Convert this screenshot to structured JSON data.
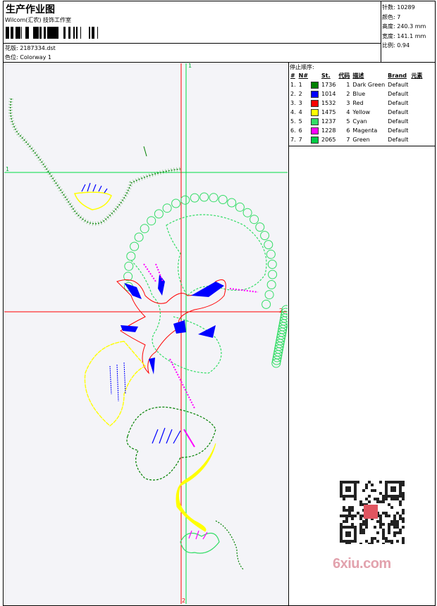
{
  "header": {
    "title": "生产作业图",
    "studio": "Wilcom(汇农) 技饰工作室",
    "design_label": "花版:",
    "design_value": "2187334.dst",
    "colorway_label": "色位:",
    "colorway_value": "Colorway 1"
  },
  "stats": [
    {
      "label": "针数:",
      "value": "10289"
    },
    {
      "label": "颜色:",
      "value": "7"
    },
    {
      "label": "高度:",
      "value": "240.3 mm"
    },
    {
      "label": "宽度:",
      "value": "141.1 mm"
    },
    {
      "label": "比例:",
      "value": "0.94"
    }
  ],
  "stop_sequence": {
    "heading": "停止顺序:",
    "columns": [
      "#",
      "N#",
      "St.",
      "代码",
      "描述",
      "Brand",
      "元素"
    ],
    "rows": [
      {
        "num": "1.",
        "n": "1",
        "color": "#008000",
        "st": "1736",
        "code": "1",
        "desc": "Dark Green",
        "brand": "Default"
      },
      {
        "num": "2.",
        "n": "2",
        "color": "#0000ff",
        "st": "1014",
        "code": "2",
        "desc": "Blue",
        "brand": "Default"
      },
      {
        "num": "3.",
        "n": "3",
        "color": "#ff0000",
        "st": "1532",
        "code": "3",
        "desc": "Red",
        "brand": "Default"
      },
      {
        "num": "4.",
        "n": "4",
        "color": "#ffff00",
        "st": "1475",
        "code": "4",
        "desc": "Yellow",
        "brand": "Default"
      },
      {
        "num": "5.",
        "n": "5",
        "color": "#33dd66",
        "st": "1237",
        "code": "5",
        "desc": "Cyan",
        "brand": "Default"
      },
      {
        "num": "6.",
        "n": "6",
        "color": "#ff00ff",
        "st": "1228",
        "code": "6",
        "desc": "Magenta",
        "brand": "Default"
      },
      {
        "num": "7.",
        "n": "7",
        "color": "#00cc44",
        "st": "2065",
        "code": "7",
        "desc": "Green",
        "brand": "Default"
      }
    ]
  },
  "guides": {
    "v_green": "1",
    "h_green": "1",
    "h_red": "2",
    "v_red": "2"
  },
  "colors": {
    "dark_green": "#008000",
    "blue": "#0000ff",
    "red": "#ff0000",
    "yellow": "#ffff00",
    "cyan": "#33dd66",
    "magenta": "#ff00ff",
    "green": "#00cc44"
  },
  "watermark": {
    "brand": "6xiu.com",
    "icon": "qr-code-icon"
  }
}
